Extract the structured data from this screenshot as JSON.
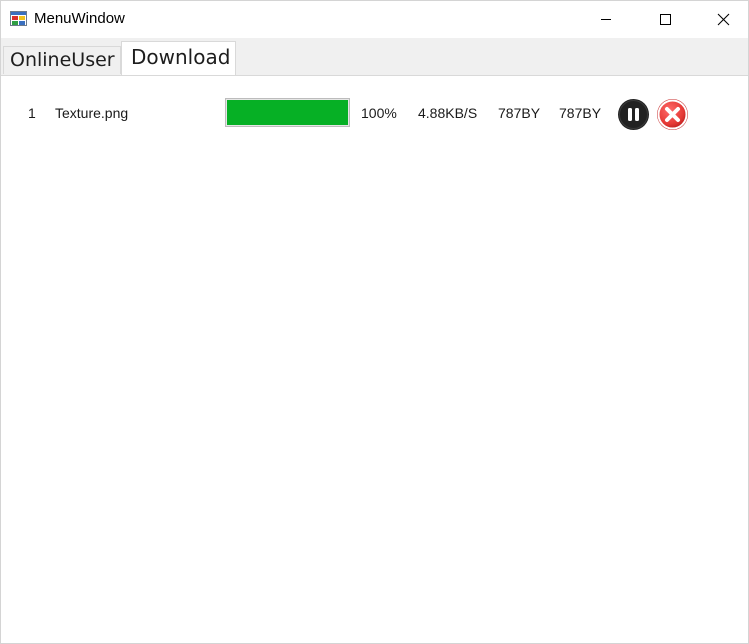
{
  "window": {
    "title": "MenuWindow",
    "icon": "app-window-icon"
  },
  "tabs": [
    {
      "label": "OnlineUser",
      "selected": false
    },
    {
      "label": "Download",
      "selected": true
    }
  ],
  "downloads": [
    {
      "index": "1",
      "filename": "Texture.png",
      "progress": 1.0,
      "progress_text": "100%",
      "speed": "4.88KB/S",
      "downloaded": "787BY",
      "total": "787BY",
      "actions": [
        "pause-icon",
        "cancel-icon"
      ]
    }
  ],
  "colors": {
    "progress": "#06b025",
    "cancel": "#e53935",
    "pause": "#222222"
  }
}
